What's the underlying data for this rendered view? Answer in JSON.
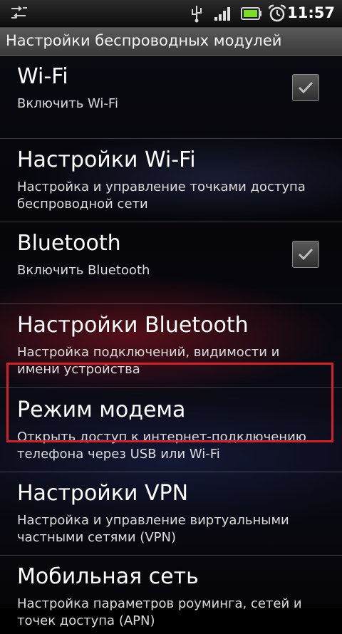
{
  "statusbar": {
    "time": "11:57",
    "icons": [
      "usb-debug-icon",
      "usb-connection-icon",
      "signal-icon",
      "battery-icon",
      "alarm-icon"
    ]
  },
  "titlebar": {
    "title": "Настройки беспроводных модулей"
  },
  "items": [
    {
      "title": "Wi-Fi",
      "subtitle": "Включить Wi-Fi",
      "checkbox": true,
      "checked": true
    },
    {
      "title": "Настройки Wi-Fi",
      "subtitle": "Настройка и управление точками доступа беспроводной сети"
    },
    {
      "title": "Bluetooth",
      "subtitle": "Включить Bluetooth",
      "checkbox": true,
      "checked": true
    },
    {
      "title": "Настройки Bluetooth",
      "subtitle": "Настройка подключений, видимости и имени устройства"
    },
    {
      "title": "Режим модема",
      "subtitle": "Открыть доступ к интернет-подключению телефона через USB или Wi-Fi",
      "highlighted": true
    },
    {
      "title": "Настройки VPN",
      "subtitle": "Настройка и управление виртуальными частными сетями (VPN)"
    },
    {
      "title": "Мобильная сеть",
      "subtitle": "Настройка параметров роуминга, сетей и точек доступа (APN)"
    }
  ],
  "colors": {
    "highlight": "#d5202a",
    "battery": "#7cdc28"
  }
}
